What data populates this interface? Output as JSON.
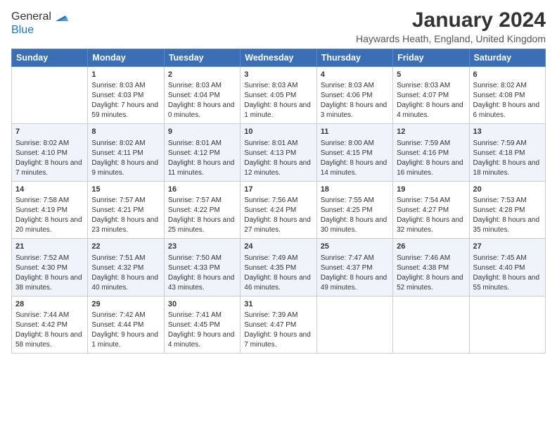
{
  "logo": {
    "line1": "General",
    "line2": "Blue"
  },
  "title": "January 2024",
  "subtitle": "Haywards Heath, England, United Kingdom",
  "days_header": [
    "Sunday",
    "Monday",
    "Tuesday",
    "Wednesday",
    "Thursday",
    "Friday",
    "Saturday"
  ],
  "weeks": [
    [
      {
        "num": "",
        "sunrise": "",
        "sunset": "",
        "daylight": ""
      },
      {
        "num": "1",
        "sunrise": "Sunrise: 8:03 AM",
        "sunset": "Sunset: 4:03 PM",
        "daylight": "Daylight: 7 hours and 59 minutes."
      },
      {
        "num": "2",
        "sunrise": "Sunrise: 8:03 AM",
        "sunset": "Sunset: 4:04 PM",
        "daylight": "Daylight: 8 hours and 0 minutes."
      },
      {
        "num": "3",
        "sunrise": "Sunrise: 8:03 AM",
        "sunset": "Sunset: 4:05 PM",
        "daylight": "Daylight: 8 hours and 1 minute."
      },
      {
        "num": "4",
        "sunrise": "Sunrise: 8:03 AM",
        "sunset": "Sunset: 4:06 PM",
        "daylight": "Daylight: 8 hours and 3 minutes."
      },
      {
        "num": "5",
        "sunrise": "Sunrise: 8:03 AM",
        "sunset": "Sunset: 4:07 PM",
        "daylight": "Daylight: 8 hours and 4 minutes."
      },
      {
        "num": "6",
        "sunrise": "Sunrise: 8:02 AM",
        "sunset": "Sunset: 4:08 PM",
        "daylight": "Daylight: 8 hours and 6 minutes."
      }
    ],
    [
      {
        "num": "7",
        "sunrise": "Sunrise: 8:02 AM",
        "sunset": "Sunset: 4:10 PM",
        "daylight": "Daylight: 8 hours and 7 minutes."
      },
      {
        "num": "8",
        "sunrise": "Sunrise: 8:02 AM",
        "sunset": "Sunset: 4:11 PM",
        "daylight": "Daylight: 8 hours and 9 minutes."
      },
      {
        "num": "9",
        "sunrise": "Sunrise: 8:01 AM",
        "sunset": "Sunset: 4:12 PM",
        "daylight": "Daylight: 8 hours and 11 minutes."
      },
      {
        "num": "10",
        "sunrise": "Sunrise: 8:01 AM",
        "sunset": "Sunset: 4:13 PM",
        "daylight": "Daylight: 8 hours and 12 minutes."
      },
      {
        "num": "11",
        "sunrise": "Sunrise: 8:00 AM",
        "sunset": "Sunset: 4:15 PM",
        "daylight": "Daylight: 8 hours and 14 minutes."
      },
      {
        "num": "12",
        "sunrise": "Sunrise: 7:59 AM",
        "sunset": "Sunset: 4:16 PM",
        "daylight": "Daylight: 8 hours and 16 minutes."
      },
      {
        "num": "13",
        "sunrise": "Sunrise: 7:59 AM",
        "sunset": "Sunset: 4:18 PM",
        "daylight": "Daylight: 8 hours and 18 minutes."
      }
    ],
    [
      {
        "num": "14",
        "sunrise": "Sunrise: 7:58 AM",
        "sunset": "Sunset: 4:19 PM",
        "daylight": "Daylight: 8 hours and 20 minutes."
      },
      {
        "num": "15",
        "sunrise": "Sunrise: 7:57 AM",
        "sunset": "Sunset: 4:21 PM",
        "daylight": "Daylight: 8 hours and 23 minutes."
      },
      {
        "num": "16",
        "sunrise": "Sunrise: 7:57 AM",
        "sunset": "Sunset: 4:22 PM",
        "daylight": "Daylight: 8 hours and 25 minutes."
      },
      {
        "num": "17",
        "sunrise": "Sunrise: 7:56 AM",
        "sunset": "Sunset: 4:24 PM",
        "daylight": "Daylight: 8 hours and 27 minutes."
      },
      {
        "num": "18",
        "sunrise": "Sunrise: 7:55 AM",
        "sunset": "Sunset: 4:25 PM",
        "daylight": "Daylight: 8 hours and 30 minutes."
      },
      {
        "num": "19",
        "sunrise": "Sunrise: 7:54 AM",
        "sunset": "Sunset: 4:27 PM",
        "daylight": "Daylight: 8 hours and 32 minutes."
      },
      {
        "num": "20",
        "sunrise": "Sunrise: 7:53 AM",
        "sunset": "Sunset: 4:28 PM",
        "daylight": "Daylight: 8 hours and 35 minutes."
      }
    ],
    [
      {
        "num": "21",
        "sunrise": "Sunrise: 7:52 AM",
        "sunset": "Sunset: 4:30 PM",
        "daylight": "Daylight: 8 hours and 38 minutes."
      },
      {
        "num": "22",
        "sunrise": "Sunrise: 7:51 AM",
        "sunset": "Sunset: 4:32 PM",
        "daylight": "Daylight: 8 hours and 40 minutes."
      },
      {
        "num": "23",
        "sunrise": "Sunrise: 7:50 AM",
        "sunset": "Sunset: 4:33 PM",
        "daylight": "Daylight: 8 hours and 43 minutes."
      },
      {
        "num": "24",
        "sunrise": "Sunrise: 7:49 AM",
        "sunset": "Sunset: 4:35 PM",
        "daylight": "Daylight: 8 hours and 46 minutes."
      },
      {
        "num": "25",
        "sunrise": "Sunrise: 7:47 AM",
        "sunset": "Sunset: 4:37 PM",
        "daylight": "Daylight: 8 hours and 49 minutes."
      },
      {
        "num": "26",
        "sunrise": "Sunrise: 7:46 AM",
        "sunset": "Sunset: 4:38 PM",
        "daylight": "Daylight: 8 hours and 52 minutes."
      },
      {
        "num": "27",
        "sunrise": "Sunrise: 7:45 AM",
        "sunset": "Sunset: 4:40 PM",
        "daylight": "Daylight: 8 hours and 55 minutes."
      }
    ],
    [
      {
        "num": "28",
        "sunrise": "Sunrise: 7:44 AM",
        "sunset": "Sunset: 4:42 PM",
        "daylight": "Daylight: 8 hours and 58 minutes."
      },
      {
        "num": "29",
        "sunrise": "Sunrise: 7:42 AM",
        "sunset": "Sunset: 4:44 PM",
        "daylight": "Daylight: 9 hours and 1 minute."
      },
      {
        "num": "30",
        "sunrise": "Sunrise: 7:41 AM",
        "sunset": "Sunset: 4:45 PM",
        "daylight": "Daylight: 9 hours and 4 minutes."
      },
      {
        "num": "31",
        "sunrise": "Sunrise: 7:39 AM",
        "sunset": "Sunset: 4:47 PM",
        "daylight": "Daylight: 9 hours and 7 minutes."
      },
      {
        "num": "",
        "sunrise": "",
        "sunset": "",
        "daylight": ""
      },
      {
        "num": "",
        "sunrise": "",
        "sunset": "",
        "daylight": ""
      },
      {
        "num": "",
        "sunrise": "",
        "sunset": "",
        "daylight": ""
      }
    ]
  ]
}
